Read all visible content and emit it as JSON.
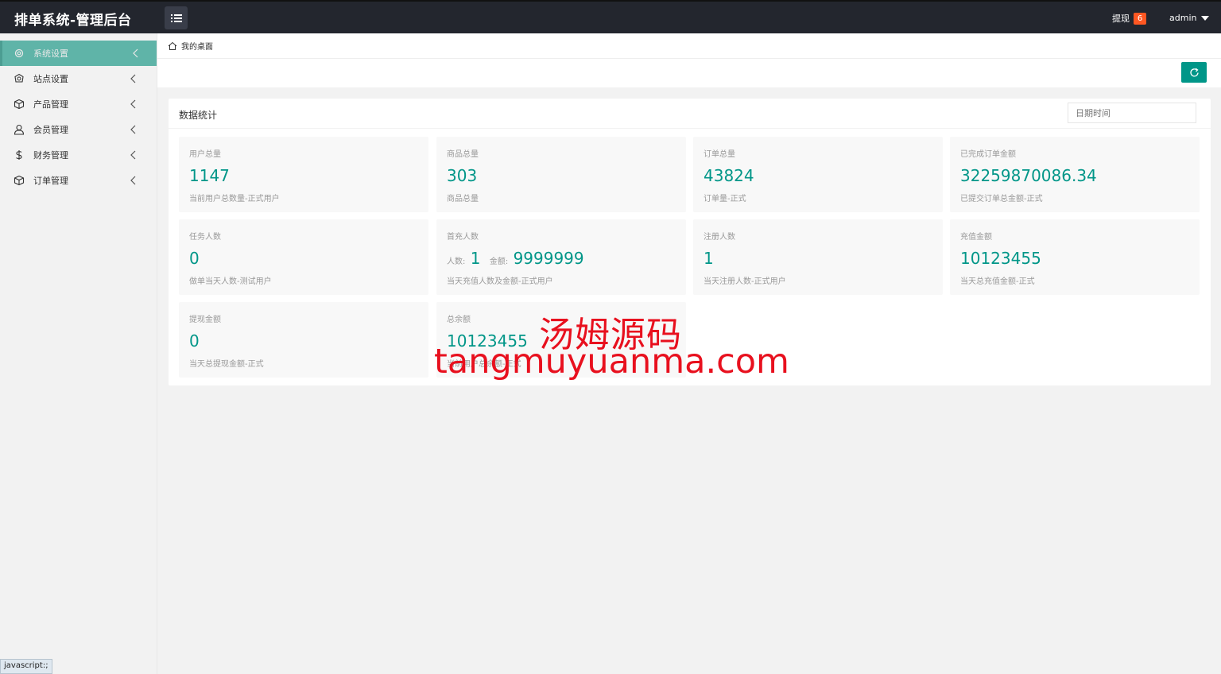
{
  "header": {
    "brand": "排单系统-管理后台",
    "withdraw_label": "提现",
    "withdraw_badge": "6",
    "user": "admin"
  },
  "sidebar": {
    "items": [
      {
        "label": "系统设置",
        "icon": "gear-icon"
      },
      {
        "label": "站点设置",
        "icon": "globe-icon"
      },
      {
        "label": "产品管理",
        "icon": "box-icon"
      },
      {
        "label": "会员管理",
        "icon": "user-icon"
      },
      {
        "label": "财务管理",
        "icon": "dollar-icon"
      },
      {
        "label": "订单管理",
        "icon": "box-icon"
      }
    ]
  },
  "breadcrumb": {
    "home": "我的桌面"
  },
  "panel": {
    "title": "数据统计",
    "date_placeholder": "日期时间"
  },
  "cards": [
    {
      "title": "用户总量",
      "value": "1147",
      "desc": "当前用户总数量-正式用户"
    },
    {
      "title": "商品总量",
      "value": "303",
      "desc": "商品总量"
    },
    {
      "title": "订单总量",
      "value": "43824",
      "desc": "订单量-正式"
    },
    {
      "title": "已完成订单金额",
      "value": "32259870086.34",
      "desc": "已提交订单总金额-正式"
    },
    {
      "title": "任务人数",
      "value": "0",
      "desc": "做单当天人数-测试用户"
    },
    {
      "title": "首充人数",
      "count_label": "人数:",
      "count": "1",
      "amount_label": "金额:",
      "amount": "9999999",
      "desc": "当天充值人数及金额-正式用户"
    },
    {
      "title": "注册人数",
      "value": "1",
      "desc": "当天注册人数-正式用户"
    },
    {
      "title": "充值金额",
      "value": "10123455",
      "desc": "当天总充值金额-正式"
    },
    {
      "title": "提现金额",
      "value": "0",
      "desc": "当天总提现金额-正式"
    },
    {
      "title": "总余额",
      "value": "10123455",
      "desc": "当前用户总余额-正式"
    }
  ],
  "watermark": {
    "cn": "汤姆源码",
    "en": "tangmuyuanma.com"
  },
  "status_link": "javascript:;"
}
